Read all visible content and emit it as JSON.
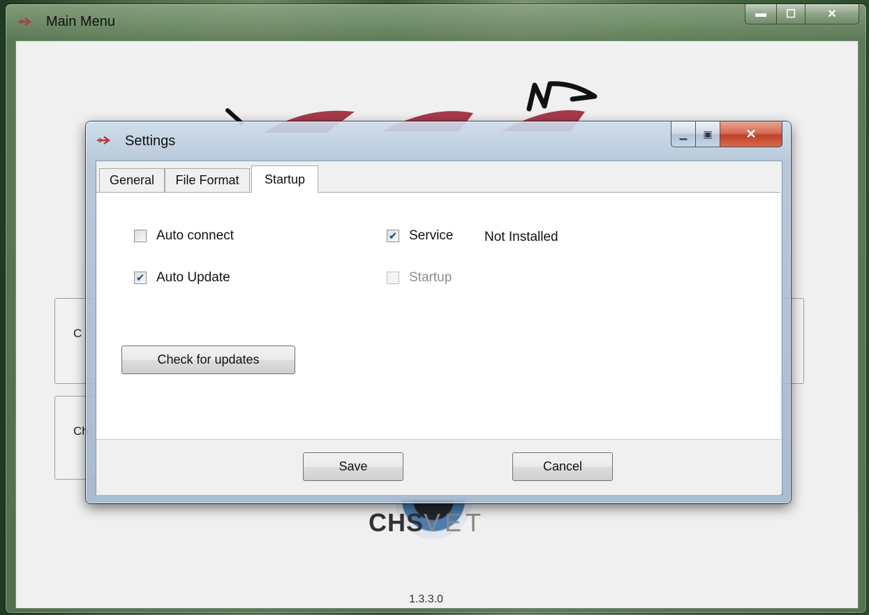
{
  "main_window": {
    "title": "Main Menu",
    "background_button_1": "C",
    "background_button_2": "Ch",
    "logo_bold": "CHS",
    "logo_light": "VET",
    "version": "1.3.3.0"
  },
  "settings": {
    "title": "Settings",
    "tabs": [
      "General",
      "File Format",
      "Startup"
    ],
    "active_tab": "Startup",
    "auto_connect": {
      "label": "Auto connect",
      "checked": false
    },
    "auto_update": {
      "label": "Auto Update",
      "checked": true
    },
    "service": {
      "label": "Service",
      "checked": true,
      "status": "Not Installed"
    },
    "startup": {
      "label": "Startup",
      "checked": false,
      "enabled": false
    },
    "check_updates_label": "Check for updates",
    "save_label": "Save",
    "cancel_label": "Cancel"
  },
  "colors": {
    "close_button": "#c8452d",
    "accent": "#1d4b86"
  }
}
